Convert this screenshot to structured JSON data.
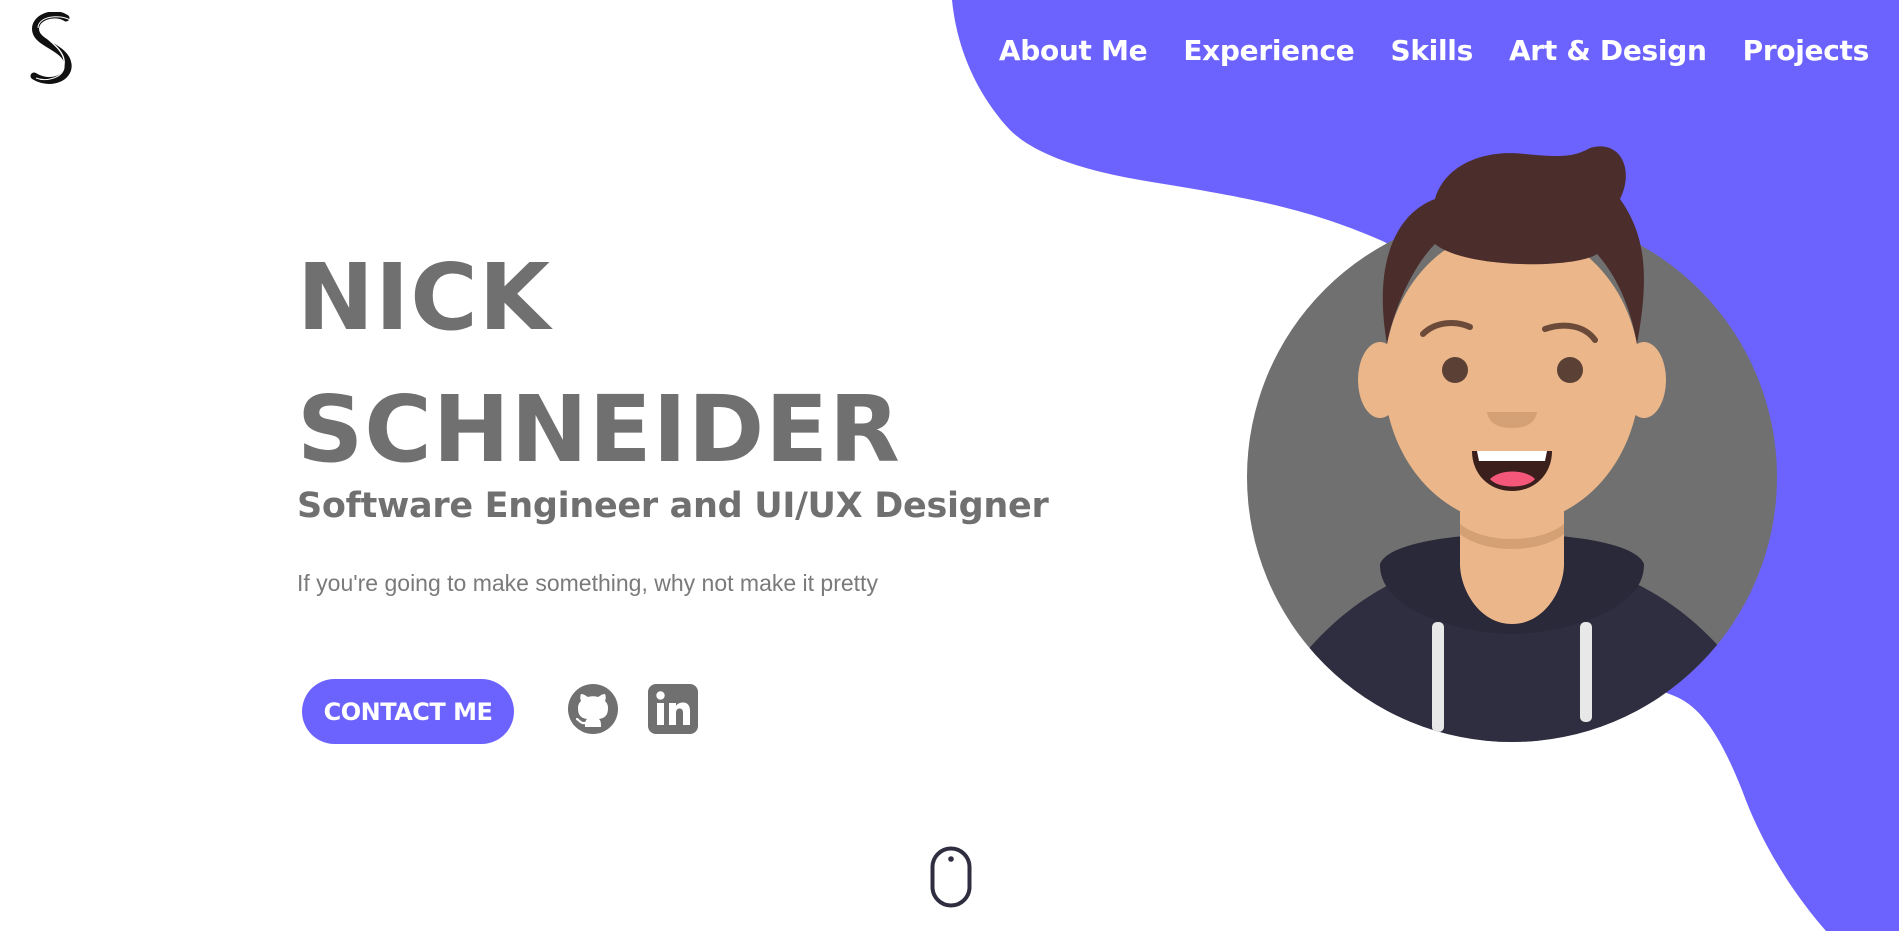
{
  "colors": {
    "accent": "#6c63ff",
    "text": "#707070",
    "hair": "#4b2e2b",
    "skin": "#ebb689",
    "hoodie": "#2f2e41",
    "circle": "#707070"
  },
  "brand": {
    "logo_icon": "s-logo-icon"
  },
  "nav": {
    "items": [
      {
        "label": "About Me"
      },
      {
        "label": "Experience"
      },
      {
        "label": "Skills"
      },
      {
        "label": "Art & Design"
      },
      {
        "label": "Projects"
      }
    ]
  },
  "hero": {
    "first_name": "NICK",
    "last_name": "SCHNEIDER",
    "subtitle": "Software Engineer and UI/UX Designer",
    "tagline": "If you're going to make something, why not make it pretty",
    "contact_label": "CONTACT ME"
  },
  "social": {
    "github_icon": "github-icon",
    "linkedin_icon": "linkedin-icon"
  },
  "scroll": {
    "icon": "mouse-scroll-icon"
  }
}
